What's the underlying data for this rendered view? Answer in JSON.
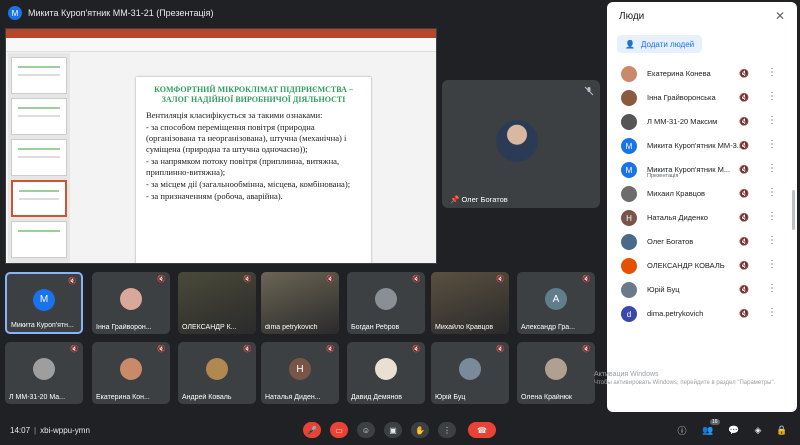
{
  "presenter": {
    "avatar_letter": "M",
    "label": "Микита Куроп'ятник ММ-31-21 (Презентація)"
  },
  "slide": {
    "title_line1": "КОМФОРТНИЙ МІКРОКЛІМАТ ПІДПРИЄМСТВА –",
    "title_line2": "ЗАЛОГ НАДІЙНОЇ ВИРОБНИЧОЇ ДІЯЛЬНОСТІ",
    "intro": "Вентиляція класифікується за такими ознаками:",
    "bullets": [
      "- за способом переміщення повітря (природна (організована та неорганізована), штучна (механічна) і суміщена (природна та штучна одночасно));",
      "- за напрямком потоку повітря (приплинна, витяжна, приплинно-витяжна);",
      "- за місцем дії (загальнообмінна, місцева, комбінована);",
      "- за призначенням (робоча, аварійна)."
    ]
  },
  "featured_tile": {
    "name": "Олег Богатов"
  },
  "grid": [
    {
      "name": "Микита Куроп'ятн...",
      "kind": "letter",
      "letter": "M",
      "color": "#1a73e8",
      "active": true
    },
    {
      "name": "Інна Грайворон...",
      "kind": "photo",
      "color": "#d9a89a"
    },
    {
      "name": "ОЛЕКСАНДР К...",
      "kind": "video",
      "color": "#4a4a3a"
    },
    {
      "name": "dima petrykovich",
      "kind": "video",
      "color": "#6b6555"
    },
    {
      "name": "Богдан Ребров",
      "kind": "photo",
      "color": "#8a8f96"
    },
    {
      "name": "Михайло Кравцов",
      "kind": "video",
      "color": "#5a5040"
    },
    {
      "name": "Александр Гра...",
      "kind": "letter",
      "letter": "A",
      "color": "#607d8b"
    },
    {
      "name": "Л ММ-31-20 Ма...",
      "kind": "photo",
      "color": "#9e9e9e"
    },
    {
      "name": "Екатерина Кон...",
      "kind": "photo",
      "color": "#c98a6a"
    },
    {
      "name": "Андрей Коваль",
      "kind": "photo",
      "color": "#b08850"
    },
    {
      "name": "Наталья Диден...",
      "kind": "letter",
      "letter": "H",
      "color": "#795548"
    },
    {
      "name": "Давид Демянов",
      "kind": "photo",
      "color": "#e8e0d0"
    },
    {
      "name": "Юрій Буц",
      "kind": "photo",
      "color": "#7a8a9a"
    },
    {
      "name": "Олена Крайнюк",
      "kind": "photo",
      "color": "#b0a090"
    }
  ],
  "meeting": {
    "time": "14:07",
    "code": "xbi-wppu-ymn"
  },
  "participant_badge": "16",
  "people_panel": {
    "title": "Люди",
    "add_label": "Додати людей",
    "people": [
      {
        "name": "Екатерина Конева",
        "kind": "photo",
        "color": "#c98a6a"
      },
      {
        "name": "Інна Грайворонська",
        "kind": "photo",
        "color": "#8a5a40"
      },
      {
        "name": "Л ММ-31-20 Максим",
        "kind": "photo",
        "color": "#555555"
      },
      {
        "name": "Микита Куроп'ятник ММ-3...",
        "kind": "letter",
        "letter": "M",
        "color": "#1a73e8"
      },
      {
        "name": "Микита Куроп'ятник М...",
        "sub": "Презентація",
        "kind": "letter",
        "letter": "M",
        "color": "#1a73e8"
      },
      {
        "name": "Михаил Кравцов",
        "kind": "photo",
        "color": "#6d6d6d"
      },
      {
        "name": "Наталья Диденко",
        "kind": "letter",
        "letter": "H",
        "color": "#795548"
      },
      {
        "name": "Олег Богатов",
        "kind": "photo",
        "color": "#4a6a8a"
      },
      {
        "name": "ОЛЕКСАНДР КОВАЛЬ",
        "kind": "photo",
        "color": "#e65100"
      },
      {
        "name": "Юрій Буц",
        "kind": "photo",
        "color": "#6a7a8a"
      },
      {
        "name": "dima.petrykovich",
        "kind": "letter",
        "letter": "d",
        "color": "#3949ab"
      }
    ]
  },
  "activation": {
    "title": "Активация Windows",
    "text": "Чтобы активировать Windows, перейдите в раздел \"Параметры\"."
  }
}
